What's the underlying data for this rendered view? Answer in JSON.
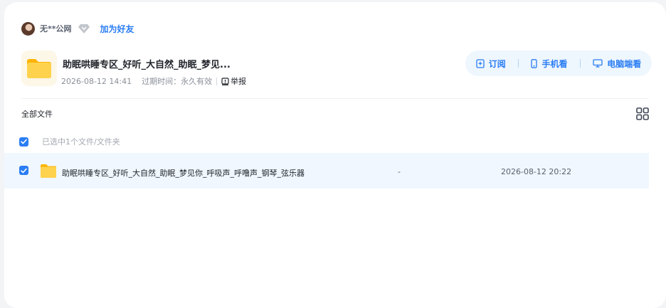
{
  "user": {
    "name": "无**公网",
    "add_friend_label": "加为好友"
  },
  "share": {
    "title": "助眠哄睡专区_好听_大自然_助眠_梦见...",
    "created": "2026-08-12 14:41",
    "expire_label": "过期时间：",
    "expire_value": "永久有效",
    "report_label": "举报"
  },
  "actions": {
    "subscribe_label": "订阅",
    "mobile_label": "手机看",
    "pc_label": "电脑端看"
  },
  "breadcrumb": {
    "root_label": "全部文件"
  },
  "selection": {
    "summary": "已选中1个文件/文件夹",
    "checked": true
  },
  "files": [
    {
      "name": "助眠哄睡专区_好听_大自然_助眠_梦见你_呼吸声_呼噜声_钢琴_弦乐器",
      "size": "-",
      "date": "2026-08-12 20:22",
      "checked": true,
      "icon": "folder-icon"
    }
  ],
  "colors": {
    "accent": "#2a7df3",
    "folder": "#ffc53d",
    "selected_row": "#f0f7fe",
    "actions_bg": "#eef6fe"
  }
}
